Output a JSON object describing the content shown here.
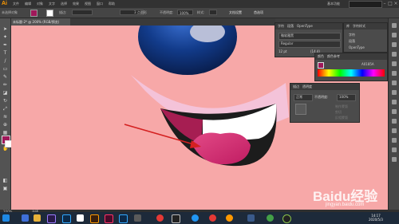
{
  "app": {
    "logo": "Ai",
    "workspace": "基本功能"
  },
  "menus": [
    "文件",
    "编辑",
    "对象",
    "文字",
    "选择",
    "效果",
    "视图",
    "窗口",
    "帮助"
  ],
  "controlbar": {
    "selection_label": "未选择对象",
    "stroke_label": "描边:",
    "stroke_style": "3 点圆形",
    "opacity_label": "不透明度:",
    "opacity_value": "100%",
    "style_label": "样式:",
    "doc_settings_button": "文档设置",
    "preferences_button": "首选项"
  },
  "document_tab": {
    "label": "未标题-2* @ 200% (RGB/预览)"
  },
  "character_panel": {
    "tabs": [
      "字符",
      "段落",
      "OpenType"
    ],
    "font_family": "微软雅黑",
    "font_style": "Regular",
    "font_size": "12 pt",
    "leading": "(14.4)"
  },
  "color_panel": {
    "tabs": [
      "颜色",
      "颜色参考"
    ],
    "hex": "A0185A",
    "accent": "#a0185a"
  },
  "transparency_panel": {
    "tabs": [
      "描边",
      "透明度"
    ],
    "blend_mode": "正常",
    "opacity_label": "不透明度:",
    "opacity_value": "100%",
    "mask_button": "制作蒙版",
    "clip_label": "剪切",
    "invert_label": "反相蒙版"
  },
  "libraries_panel": {
    "tabs": [
      "库",
      "字符样式"
    ],
    "item_1": "字符",
    "item_2": "段落",
    "item_3": "OpenType"
  },
  "statusbar": {
    "zoom": "200%",
    "tool": "选择"
  },
  "taskbar": {
    "time": "14:17",
    "date": "2020/5/3"
  },
  "watermark": {
    "main": "Baidu经验",
    "sub": "jingyan.baidu.com"
  }
}
